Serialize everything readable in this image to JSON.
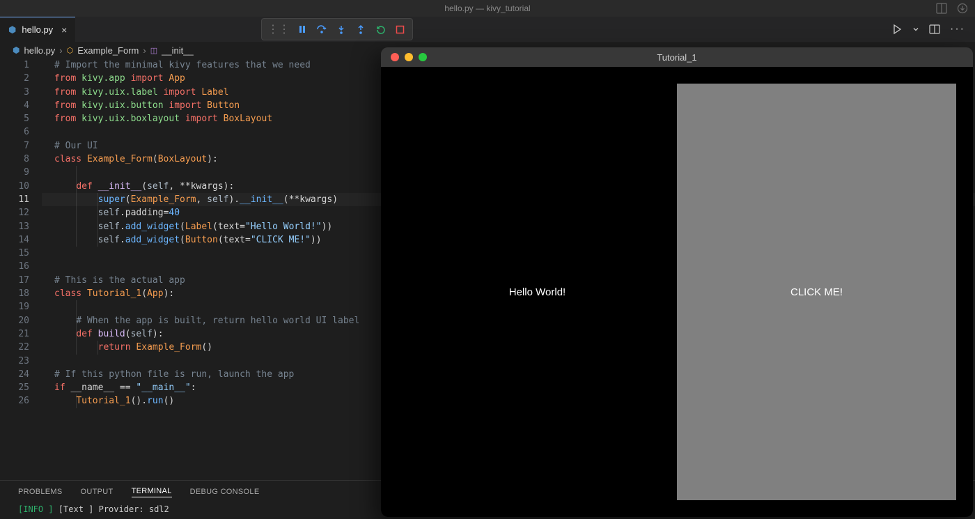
{
  "titlebar": {
    "text": "hello.py — kivy_tutorial"
  },
  "tab": {
    "filename": "hello.py"
  },
  "breadcrumb": {
    "file": "hello.py",
    "class": "Example_Form",
    "symbol": "__init__"
  },
  "debug_icons": {
    "pause": "pause",
    "step_over": "step-over",
    "step_into": "step-into",
    "step_out": "step-out",
    "restart": "restart",
    "stop": "stop"
  },
  "gutter": {
    "start": 1,
    "end": 26,
    "highlight": 11
  },
  "panel": {
    "tabs": [
      "PROBLEMS",
      "OUTPUT",
      "TERMINAL",
      "DEBUG CONSOLE"
    ],
    "active": 2,
    "log_prefix": "[INFO   ]",
    "log_rest": " [Text        ] Provider: sdl2"
  },
  "app_window": {
    "title": "Tutorial_1",
    "label_text": "Hello World!",
    "button_text": "CLICK ME!"
  },
  "code_lines": [
    {
      "indent": 0,
      "tokens": [
        [
          "cm",
          "# Import the minimal kivy features that we need"
        ]
      ]
    },
    {
      "indent": 0,
      "tokens": [
        [
          "kw",
          "from"
        ],
        [
          "op",
          " "
        ],
        [
          "mod",
          "kivy.app"
        ],
        [
          "op",
          " "
        ],
        [
          "kw",
          "import"
        ],
        [
          "op",
          " "
        ],
        [
          "cls",
          "App"
        ]
      ]
    },
    {
      "indent": 0,
      "tokens": [
        [
          "kw",
          "from"
        ],
        [
          "op",
          " "
        ],
        [
          "mod",
          "kivy.uix.label"
        ],
        [
          "op",
          " "
        ],
        [
          "kw",
          "import"
        ],
        [
          "op",
          " "
        ],
        [
          "cls",
          "Label"
        ]
      ]
    },
    {
      "indent": 0,
      "tokens": [
        [
          "kw",
          "from"
        ],
        [
          "op",
          " "
        ],
        [
          "mod",
          "kivy.uix.button"
        ],
        [
          "op",
          " "
        ],
        [
          "kw",
          "import"
        ],
        [
          "op",
          " "
        ],
        [
          "cls",
          "Button"
        ]
      ]
    },
    {
      "indent": 0,
      "tokens": [
        [
          "kw",
          "from"
        ],
        [
          "op",
          " "
        ],
        [
          "mod",
          "kivy.uix.boxlayout"
        ],
        [
          "op",
          " "
        ],
        [
          "kw",
          "import"
        ],
        [
          "op",
          " "
        ],
        [
          "cls",
          "BoxLayout"
        ]
      ]
    },
    {
      "indent": 0,
      "tokens": []
    },
    {
      "indent": 0,
      "tokens": [
        [
          "cm",
          "# Our UI"
        ]
      ]
    },
    {
      "indent": 0,
      "tokens": [
        [
          "kw",
          "class"
        ],
        [
          "op",
          " "
        ],
        [
          "cls",
          "Example_Form"
        ],
        [
          "op",
          "("
        ],
        [
          "cls",
          "BoxLayout"
        ],
        [
          "op",
          "):"
        ]
      ]
    },
    {
      "indent": 0,
      "tokens": [],
      "guides": [
        1
      ]
    },
    {
      "indent": 1,
      "tokens": [
        [
          "kw",
          "def"
        ],
        [
          "op",
          " "
        ],
        [
          "def",
          "__init__"
        ],
        [
          "op",
          "("
        ],
        [
          "self",
          "self"
        ],
        [
          "op",
          ", "
        ],
        [
          "op",
          "**"
        ],
        [
          "var",
          "kwargs"
        ],
        [
          "op",
          "):"
        ]
      ],
      "guides": [
        1
      ]
    },
    {
      "indent": 2,
      "tokens": [
        [
          "fn",
          "super"
        ],
        [
          "op",
          "("
        ],
        [
          "cls",
          "Example_Form"
        ],
        [
          "op",
          ", "
        ],
        [
          "self",
          "self"
        ],
        [
          "op",
          ")."
        ],
        [
          "fn",
          "__init__"
        ],
        [
          "op",
          "("
        ],
        [
          "op",
          "**"
        ],
        [
          "var",
          "kwargs"
        ],
        [
          "op",
          ")"
        ]
      ],
      "guides": [
        1,
        2
      ],
      "hl": true
    },
    {
      "indent": 2,
      "tokens": [
        [
          "self",
          "self"
        ],
        [
          "op",
          "."
        ],
        [
          "var",
          "padding"
        ],
        [
          "op",
          "="
        ],
        [
          "num",
          "40"
        ]
      ],
      "guides": [
        1,
        2
      ]
    },
    {
      "indent": 2,
      "tokens": [
        [
          "self",
          "self"
        ],
        [
          "op",
          "."
        ],
        [
          "fn",
          "add_widget"
        ],
        [
          "op",
          "("
        ],
        [
          "cls",
          "Label"
        ],
        [
          "op",
          "("
        ],
        [
          "var",
          "text"
        ],
        [
          "op",
          "="
        ],
        [
          "str",
          "\"Hello World!\""
        ],
        [
          "op",
          "))"
        ]
      ],
      "guides": [
        1,
        2
      ]
    },
    {
      "indent": 2,
      "tokens": [
        [
          "self",
          "self"
        ],
        [
          "op",
          "."
        ],
        [
          "fn",
          "add_widget"
        ],
        [
          "op",
          "("
        ],
        [
          "cls",
          "Button"
        ],
        [
          "op",
          "("
        ],
        [
          "var",
          "text"
        ],
        [
          "op",
          "="
        ],
        [
          "str",
          "\"CLICK ME!\""
        ],
        [
          "op",
          "))"
        ]
      ],
      "guides": [
        1,
        2
      ]
    },
    {
      "indent": 0,
      "tokens": []
    },
    {
      "indent": 0,
      "tokens": []
    },
    {
      "indent": 0,
      "tokens": [
        [
          "cm",
          "# This is the actual app"
        ]
      ]
    },
    {
      "indent": 0,
      "tokens": [
        [
          "kw",
          "class"
        ],
        [
          "op",
          " "
        ],
        [
          "cls",
          "Tutorial_1"
        ],
        [
          "op",
          "("
        ],
        [
          "cls",
          "App"
        ],
        [
          "op",
          "):"
        ]
      ]
    },
    {
      "indent": 0,
      "tokens": [],
      "guides": [
        1
      ]
    },
    {
      "indent": 1,
      "tokens": [
        [
          "cm",
          "# When the app is built, return hello world UI label"
        ]
      ],
      "guides": [
        1
      ]
    },
    {
      "indent": 1,
      "tokens": [
        [
          "kw",
          "def"
        ],
        [
          "op",
          " "
        ],
        [
          "def",
          "build"
        ],
        [
          "op",
          "("
        ],
        [
          "self",
          "self"
        ],
        [
          "op",
          "):"
        ]
      ],
      "guides": [
        1
      ]
    },
    {
      "indent": 2,
      "tokens": [
        [
          "kw",
          "return"
        ],
        [
          "op",
          " "
        ],
        [
          "cls",
          "Example_Form"
        ],
        [
          "op",
          "()"
        ]
      ],
      "guides": [
        1,
        2
      ]
    },
    {
      "indent": 0,
      "tokens": []
    },
    {
      "indent": 0,
      "tokens": [
        [
          "cm",
          "# If this python file is run, launch the app"
        ]
      ]
    },
    {
      "indent": 0,
      "tokens": [
        [
          "kw",
          "if"
        ],
        [
          "op",
          " "
        ],
        [
          "var",
          "__name__"
        ],
        [
          "op",
          " == "
        ],
        [
          "str",
          "\"__main__\""
        ],
        [
          "op",
          ":"
        ]
      ]
    },
    {
      "indent": 1,
      "tokens": [
        [
          "cls",
          "Tutorial_1"
        ],
        [
          "op",
          "()."
        ],
        [
          "fn",
          "run"
        ],
        [
          "op",
          "()"
        ]
      ],
      "guides": [
        1
      ]
    }
  ]
}
